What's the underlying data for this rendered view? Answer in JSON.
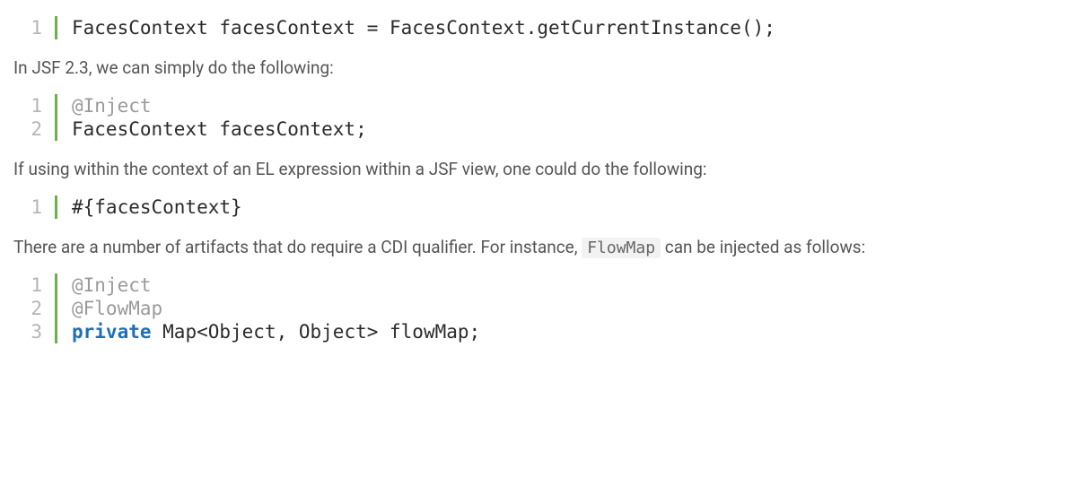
{
  "code1": {
    "lines": [
      "1"
    ],
    "content": [
      [
        {
          "cls": "tok-plain",
          "text": "FacesContext facesContext = FacesContext.getCurrentInstance();"
        }
      ]
    ]
  },
  "para1": "In JSF 2.3, we can simply do the following:",
  "code2": {
    "lines": [
      "1",
      "2"
    ],
    "content": [
      [
        {
          "cls": "tok-annotation",
          "text": "@Inject"
        }
      ],
      [
        {
          "cls": "tok-plain",
          "text": "FacesContext facesContext;"
        }
      ]
    ]
  },
  "para2": "If using within the context of an EL expression within a JSF view, one could do the following:",
  "code3": {
    "lines": [
      "1"
    ],
    "content": [
      [
        {
          "cls": "tok-dim",
          "text": "#{facesContext}"
        }
      ]
    ]
  },
  "para3_before": "There are a number of artifacts that do require a CDI qualifier.  For instance, ",
  "para3_code": "FlowMap",
  "para3_after": " can be injected as follows:",
  "code4": {
    "lines": [
      "1",
      "2",
      "3"
    ],
    "content": [
      [
        {
          "cls": "tok-annotation",
          "text": "@Inject"
        }
      ],
      [
        {
          "cls": "tok-annotation",
          "text": "@FlowMap"
        }
      ],
      [
        {
          "cls": "tok-keyword",
          "text": "private"
        },
        {
          "cls": "tok-plain",
          "text": " Map<Object, Object> flowMap;"
        }
      ]
    ]
  }
}
